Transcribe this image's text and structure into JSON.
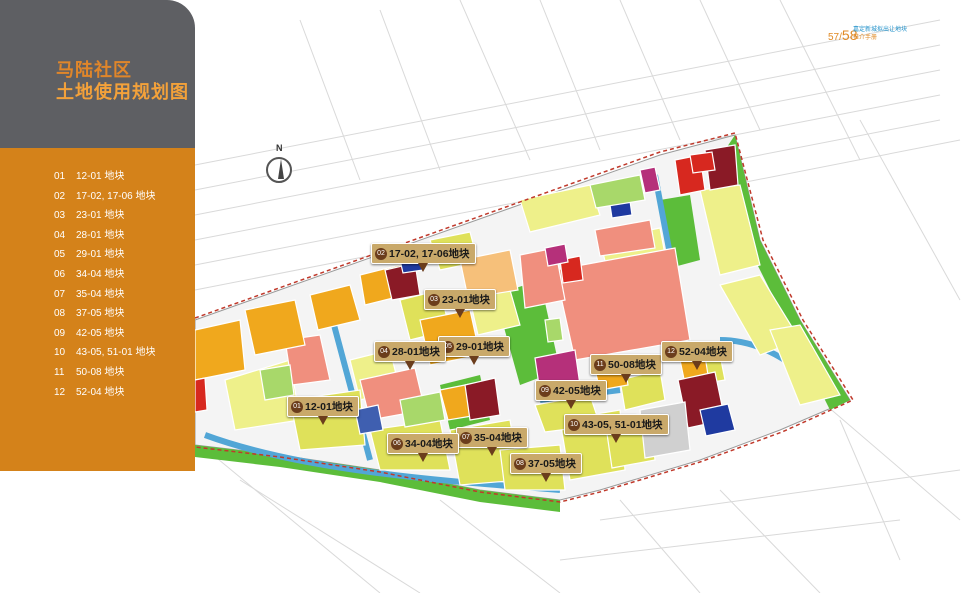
{
  "title": {
    "line1": "马陆社区",
    "line2": "土地使用规划图"
  },
  "page_number": {
    "current": "57",
    "total": "58",
    "separator": "/"
  },
  "header_text": {
    "line1": "嘉定新城拟出让地块",
    "line2": "推介手册"
  },
  "north_label": "N",
  "parcel_list": [
    {
      "num": "01",
      "label": "12-01 地块"
    },
    {
      "num": "02",
      "label": "17-02, 17-06 地块"
    },
    {
      "num": "03",
      "label": "23-01 地块"
    },
    {
      "num": "04",
      "label": "28-01 地块"
    },
    {
      "num": "05",
      "label": "29-01 地块"
    },
    {
      "num": "06",
      "label": "34-04 地块"
    },
    {
      "num": "07",
      "label": "35-04 地块"
    },
    {
      "num": "08",
      "label": "37-05 地块"
    },
    {
      "num": "09",
      "label": "42-05 地块"
    },
    {
      "num": "10",
      "label": "43-05, 51-01 地块"
    },
    {
      "num": "11",
      "label": "50-08 地块"
    },
    {
      "num": "12",
      "label": "52-04 地块"
    }
  ],
  "map_tags": [
    {
      "num": "02",
      "label": "17-02, 17-06地块"
    },
    {
      "num": "03",
      "label": "23-01地块"
    },
    {
      "num": "05",
      "label": "29-01地块"
    },
    {
      "num": "04",
      "label": "28-01地块"
    },
    {
      "num": "11",
      "label": "50-08地块"
    },
    {
      "num": "12",
      "label": "52-04地块"
    },
    {
      "num": "09",
      "label": "42-05地块"
    },
    {
      "num": "01",
      "label": "12-01地块"
    },
    {
      "num": "10",
      "label": "43-05, 51-01地块"
    },
    {
      "num": "07",
      "label": "35-04地块"
    },
    {
      "num": "06",
      "label": "34-04地块"
    },
    {
      "num": "08",
      "label": "37-05地块"
    }
  ],
  "colors": {
    "residential": "#eef08a",
    "commercial": "#f08f7e",
    "education": "#f0a81d",
    "green": "#5cbd3a",
    "water": "#52a6d6",
    "industrial_red": "#d7281f",
    "dark_red": "#8a1a26",
    "magenta": "#b5307a",
    "blue": "#1f3aa0",
    "tag_bg": "#c9a96a",
    "accent": "#d4821a"
  }
}
